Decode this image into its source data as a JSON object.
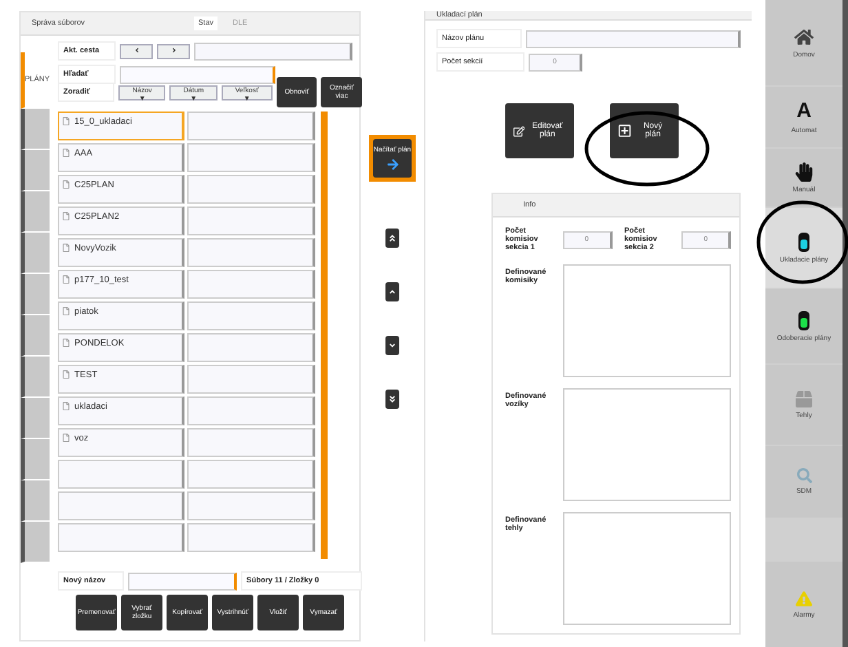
{
  "file_panel": {
    "title": "Správa súborov",
    "breadcrumb": [
      "Stav",
      "DLE"
    ],
    "tabs": [
      {
        "label": "PLÁNY",
        "selected": true
      }
    ],
    "path_label": "Akt. cesta",
    "search_label": "Hľadať",
    "sort_label": "Zoradiť",
    "sort_buttons": [
      "Názov ▼",
      "Dátum ▼",
      "Veľkosť ▼"
    ],
    "refresh": "Obnoviť",
    "multi_select": "Označiť viac",
    "files": [
      {
        "name": "15_0_ukladaci",
        "selected": true
      },
      {
        "name": "AAA",
        "selected": false
      },
      {
        "name": "C25PLAN",
        "selected": false
      },
      {
        "name": "C25PLAN2",
        "selected": false
      },
      {
        "name": "NovyVozik",
        "selected": false
      },
      {
        "name": "p177_10_test",
        "selected": false
      },
      {
        "name": "piatok",
        "selected": false
      },
      {
        "name": "PONDELOK",
        "selected": false
      },
      {
        "name": "TEST",
        "selected": false
      },
      {
        "name": "ukladaci",
        "selected": false
      },
      {
        "name": "voz",
        "selected": false
      }
    ],
    "load_button": "Načítať plán",
    "new_name_label": "Nový názov",
    "counts": "Súbory 11 / Zložky 0",
    "actions": [
      "Premenovať",
      "Vybrať zložku",
      "Kopírovať",
      "Vystrihnúť",
      "Vložiť",
      "Vymazať"
    ]
  },
  "plan_panel": {
    "title": "Ukladací plán",
    "name_label": "Názov plánu",
    "sections_label": "Počet sekcií",
    "sections_value": "0",
    "edit_button": "Editovať plán",
    "new_button": "Nový plán",
    "info": {
      "title": "Info",
      "fields": [
        {
          "label": "Počet komisiov sekcia 1",
          "value": "0"
        },
        {
          "label": "Počet komisiov sekcia 2",
          "value": "0"
        }
      ],
      "lists": [
        "Definované komisiky",
        "Definované vozíky",
        "Definované tehly"
      ]
    }
  },
  "sidebar": [
    {
      "label": "Domov",
      "kind": "home",
      "selected": false
    },
    {
      "label": "Automat",
      "kind": "letter",
      "glyph": "A",
      "selected": false
    },
    {
      "label": "Manuál",
      "kind": "hand",
      "selected": false
    },
    {
      "label": "Ukladacie plány",
      "kind": "cyan",
      "selected": true
    },
    {
      "label": "Odoberacie plány",
      "kind": "green",
      "selected": false
    },
    {
      "label": "Tehly",
      "kind": "box",
      "selected": false
    },
    {
      "label": "SDM",
      "kind": "search",
      "selected": false
    },
    {
      "label": "Alarmy",
      "kind": "warn",
      "selected": false
    }
  ]
}
